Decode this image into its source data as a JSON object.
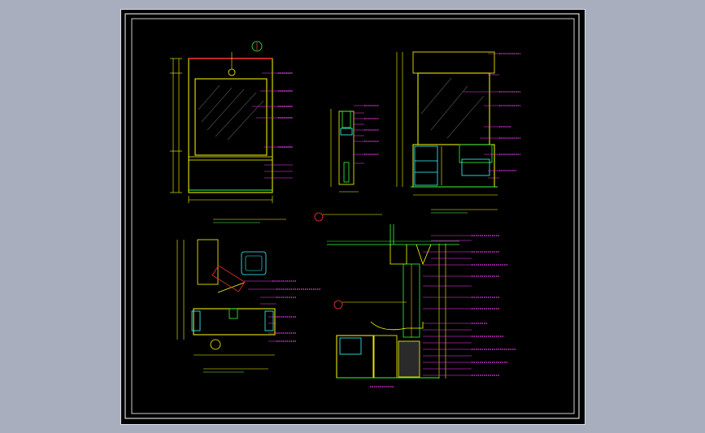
{
  "drawing": {
    "colors": {
      "page_bg": "#a9aebf",
      "sheet_bg": "#000000",
      "frame": "#ffffff",
      "linework": "#ffff00",
      "annotation": "#ff3cff",
      "green": "#33ff33",
      "cyan": "#33ffff",
      "red": "#ff3333",
      "blue": "#5a6cff"
    }
  }
}
